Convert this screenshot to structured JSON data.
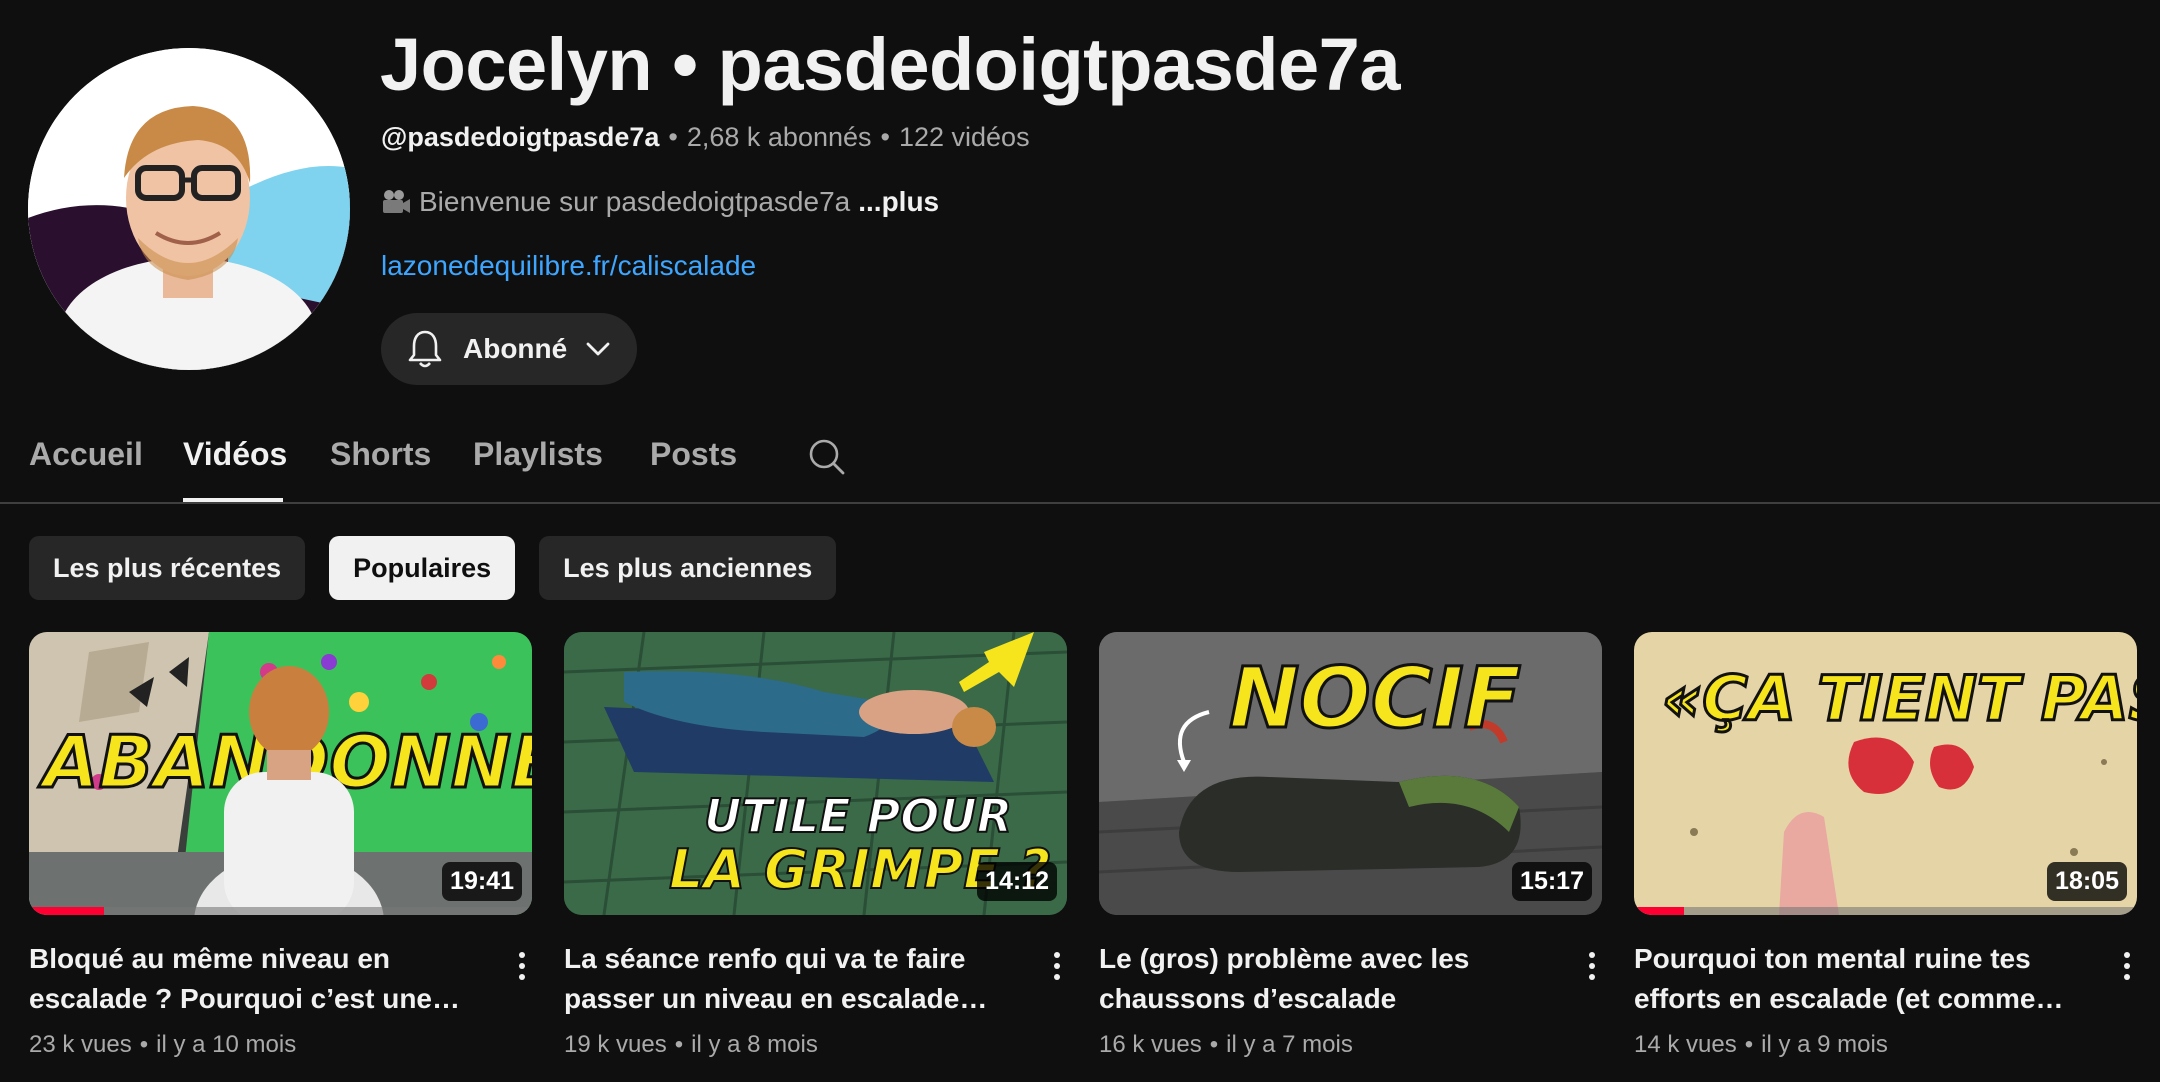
{
  "channel": {
    "name": "Jocelyn • pasdedoigtpasde7a",
    "handle": "@pasdedoigtpasde7a",
    "subscribers": "2,68 k abonnés",
    "videos_count": "122 vidéos",
    "separator": "•",
    "description": "Bienvenue sur pasdedoigtpasde7a",
    "more_label": "...plus",
    "link": "lazonedequilibre.fr/caliscalade",
    "subscribe_label": "Abonné"
  },
  "tabs": [
    {
      "label": "Accueil"
    },
    {
      "label": "Vidéos",
      "active": true
    },
    {
      "label": "Shorts"
    },
    {
      "label": "Playlists"
    },
    {
      "label": "Posts"
    }
  ],
  "chips": [
    {
      "label": "Les plus récentes"
    },
    {
      "label": "Populaires",
      "selected": true
    },
    {
      "label": "Les plus anciennes"
    }
  ],
  "videos": [
    {
      "title": "Bloqué au même niveau en escalade ? Pourquoi c’est une…",
      "views": "23 k vues",
      "age": "il y a 10 mois",
      "duration": "19:41",
      "watched_fraction": 0.15,
      "thumb_text": "ABANDONNER?"
    },
    {
      "title": "La séance renfo qui va te faire passer un niveau en escalade (san…",
      "views": "19 k vues",
      "age": "il y a 8 mois",
      "duration": "14:12",
      "watched_fraction": 0,
      "thumb_text_1": "UTILE POUR",
      "thumb_text_2": "LA GRIMPE ?"
    },
    {
      "title": "Le (gros) problème avec les chaussons d’escalade",
      "views": "16 k vues",
      "age": "il y a 7 mois",
      "duration": "15:17",
      "watched_fraction": 0,
      "thumb_text": "NOCIF"
    },
    {
      "title": "Pourquoi ton mental ruine tes efforts en escalade (et comment y…",
      "views": "14 k vues",
      "age": "il y a 9 mois",
      "duration": "18:05",
      "watched_fraction": 0.1,
      "thumb_text": "«ÇA TIENT PAS»"
    }
  ],
  "colors": {
    "background": "#0f0f0f",
    "link": "#3ea6ff",
    "progress": "#ff0033",
    "chip": "#272727"
  },
  "icons": [
    "video-camera-icon",
    "bell-icon",
    "chevron-down-icon",
    "search-icon",
    "more-vert-icon"
  ]
}
